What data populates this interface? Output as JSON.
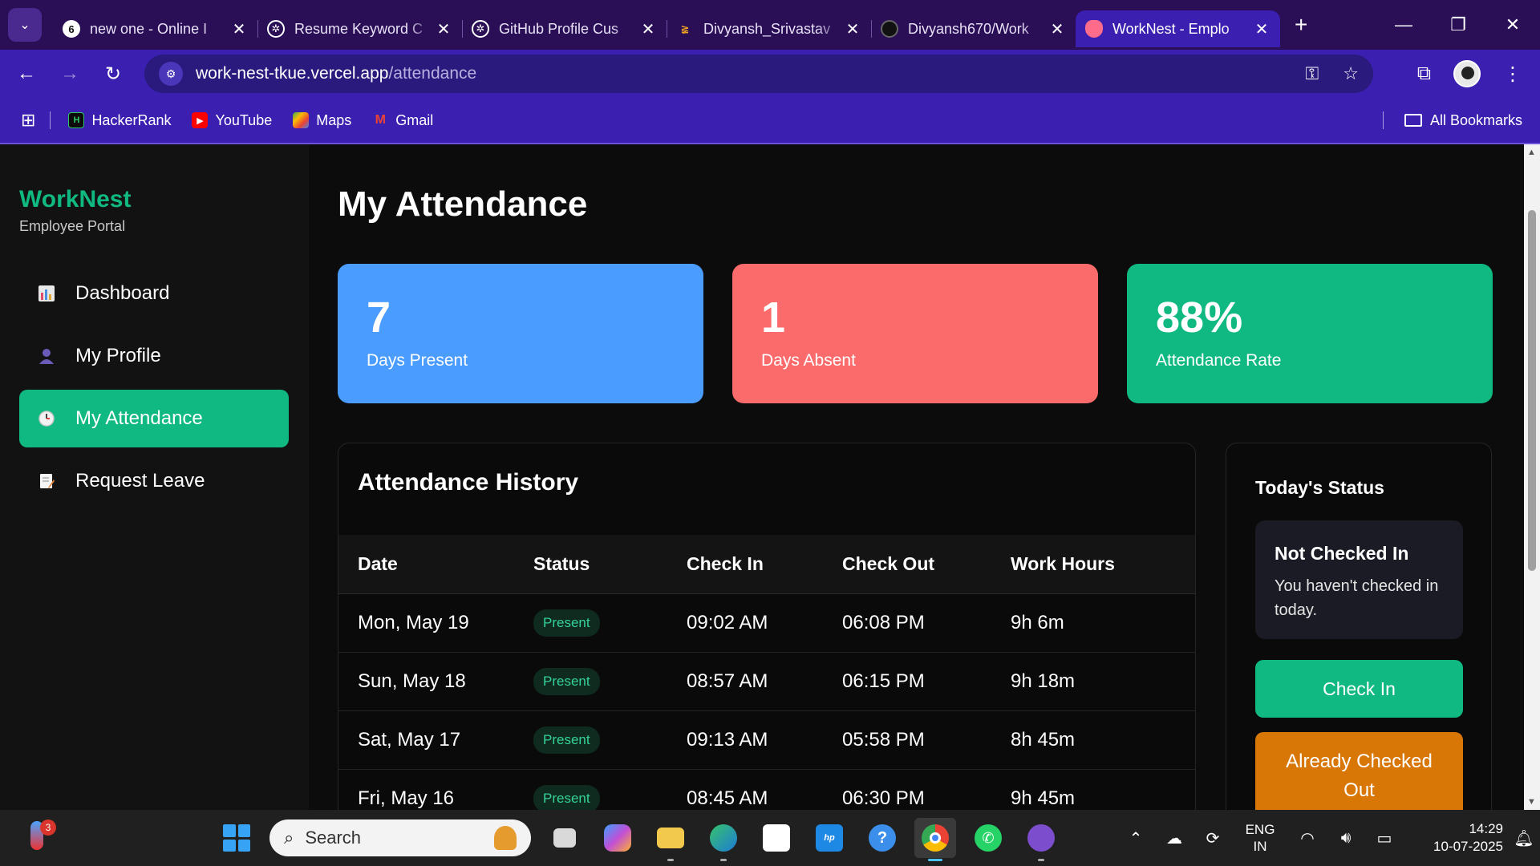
{
  "browser": {
    "tabs": [
      {
        "title": "new one - Online I",
        "active": false
      },
      {
        "title": "Resume Keyword C",
        "active": false
      },
      {
        "title": "GitHub Profile Cus",
        "active": false
      },
      {
        "title": "Divyansh_Srivastav",
        "active": false
      },
      {
        "title": "Divyansh670/Work",
        "active": false
      },
      {
        "title": "WorkNest - Emplo",
        "active": true
      }
    ],
    "url_host": "work-nest-tkue.vercel.app",
    "url_path": "/attendance",
    "bookmarks": [
      {
        "label": "HackerRank",
        "icon": "hackerrank-icon"
      },
      {
        "label": "YouTube",
        "icon": "youtube-icon"
      },
      {
        "label": "Maps",
        "icon": "maps-icon"
      },
      {
        "label": "Gmail",
        "icon": "gmail-icon"
      }
    ],
    "all_bookmarks": "All Bookmarks"
  },
  "sidebar": {
    "brand": "WorkNest",
    "subtitle": "Employee Portal",
    "items": [
      {
        "label": "Dashboard",
        "icon": "chart-icon",
        "active": false
      },
      {
        "label": "My Profile",
        "icon": "user-icon",
        "active": false
      },
      {
        "label": "My Attendance",
        "icon": "clock-icon",
        "active": true
      },
      {
        "label": "Request Leave",
        "icon": "memo-icon",
        "active": false
      }
    ]
  },
  "main": {
    "title": "My Attendance",
    "stats": [
      {
        "value": "7",
        "label": "Days Present",
        "color": "#4a9dff"
      },
      {
        "value": "1",
        "label": "Days Absent",
        "color": "#fb6b6b"
      },
      {
        "value": "88%",
        "label": "Attendance Rate",
        "color": "#10b981"
      }
    ],
    "history": {
      "title": "Attendance History",
      "columns": [
        "Date",
        "Status",
        "Check In",
        "Check Out",
        "Work Hours"
      ],
      "rows": [
        {
          "date": "Mon, May 19",
          "status": "Present",
          "check_in": "09:02 AM",
          "check_out": "06:08 PM",
          "hours": "9h 6m"
        },
        {
          "date": "Sun, May 18",
          "status": "Present",
          "check_in": "08:57 AM",
          "check_out": "06:15 PM",
          "hours": "9h 18m"
        },
        {
          "date": "Sat, May 17",
          "status": "Present",
          "check_in": "09:13 AM",
          "check_out": "05:58 PM",
          "hours": "8h 45m"
        },
        {
          "date": "Fri, May 16",
          "status": "Present",
          "check_in": "08:45 AM",
          "check_out": "06:30 PM",
          "hours": "9h 45m"
        }
      ]
    },
    "today": {
      "title": "Today's Status",
      "status_heading": "Not Checked In",
      "status_text": "You haven't checked in today.",
      "check_in_label": "Check In",
      "checked_out_label": "Already Checked Out"
    }
  },
  "taskbar": {
    "search_placeholder": "Search",
    "notification_count": "3",
    "language": "ENG",
    "region": "IN",
    "time": "14:29",
    "date": "10-07-2025"
  }
}
